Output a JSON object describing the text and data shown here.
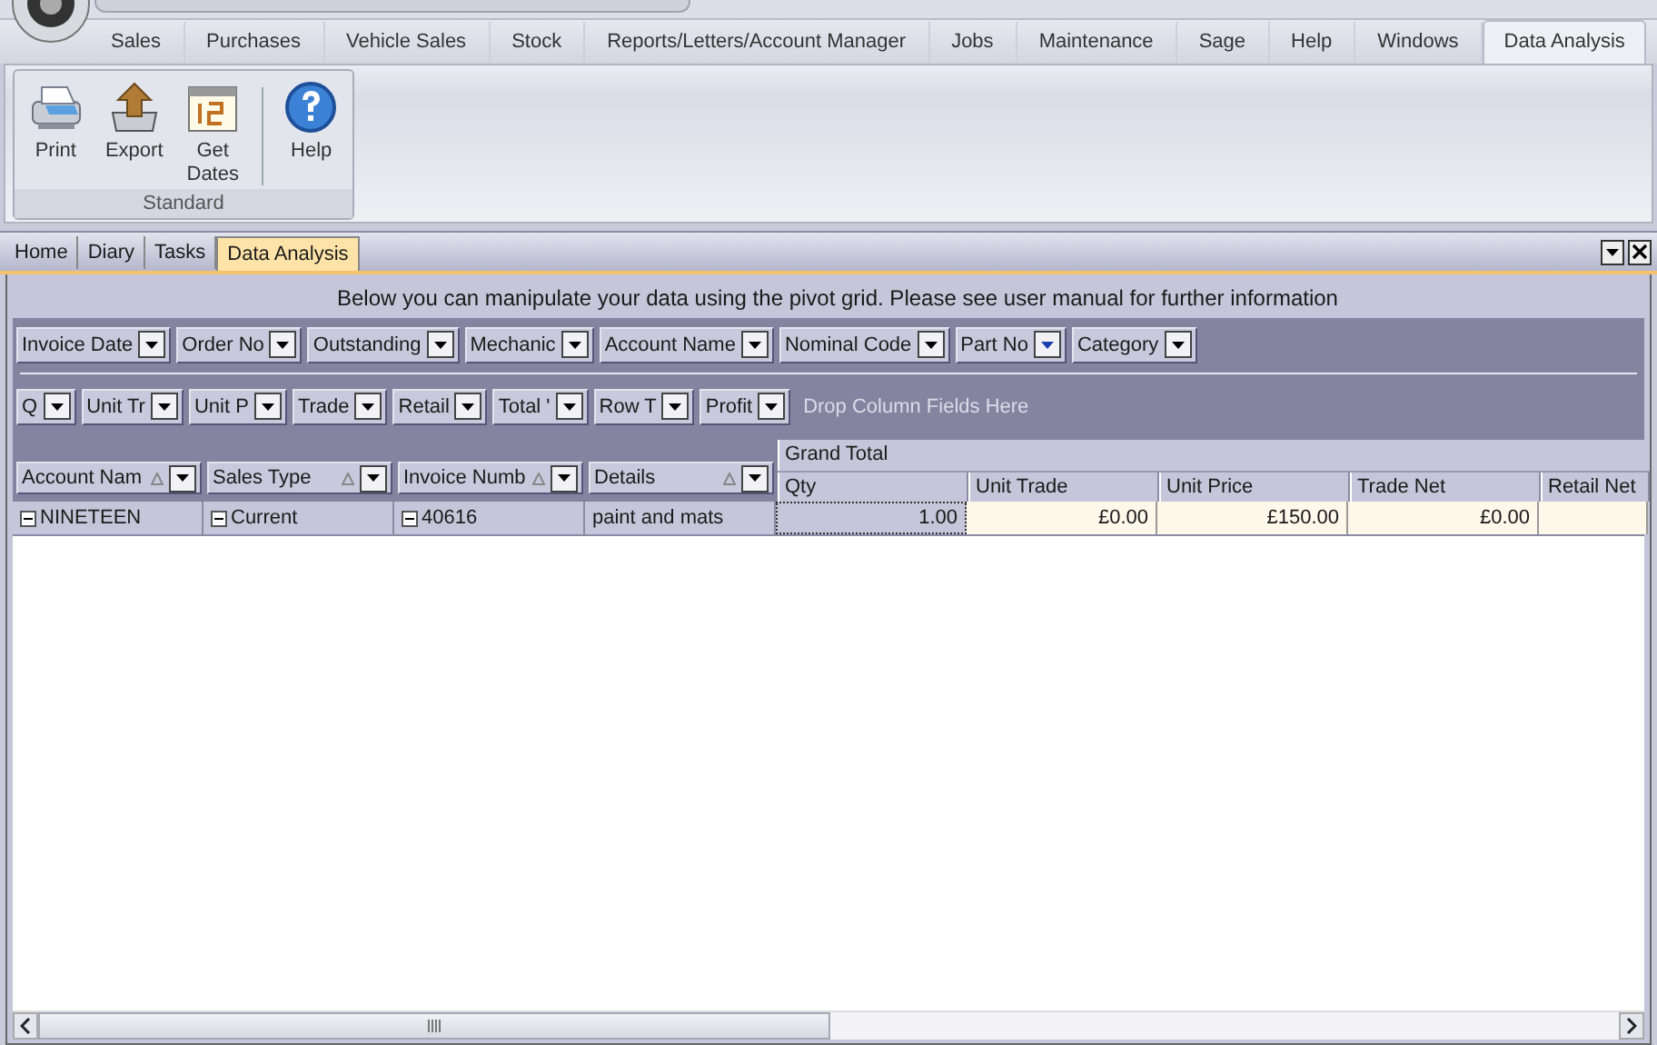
{
  "ribbon_tabs": [
    {
      "label": "Sales",
      "selected": false
    },
    {
      "label": "Purchases",
      "selected": false
    },
    {
      "label": "Vehicle Sales",
      "selected": false
    },
    {
      "label": "Stock",
      "selected": false
    },
    {
      "label": "Reports/Letters/Account Manager",
      "selected": false
    },
    {
      "label": "Jobs",
      "selected": false
    },
    {
      "label": "Maintenance",
      "selected": false
    },
    {
      "label": "Sage",
      "selected": false
    },
    {
      "label": "Help",
      "selected": false
    },
    {
      "label": "Windows",
      "selected": false
    },
    {
      "label": "Data Analysis",
      "selected": true
    }
  ],
  "ribbon_group": {
    "title": "Standard",
    "buttons": [
      {
        "label": "Print",
        "kind": "print"
      },
      {
        "label": "Export",
        "kind": "export"
      },
      {
        "label": "Get Dates",
        "kind": "calendar"
      },
      {
        "label": "Help",
        "kind": "help"
      }
    ]
  },
  "doc_tabs": [
    {
      "label": "Home",
      "selected": false
    },
    {
      "label": "Diary",
      "selected": false
    },
    {
      "label": "Tasks",
      "selected": false
    },
    {
      "label": "Data Analysis",
      "selected": true
    }
  ],
  "info_text": "Below you can manipulate your data using the pivot grid.  Please see user manual for further information",
  "filter_fields": [
    {
      "label": "Invoice Date",
      "filtered": false
    },
    {
      "label": "Order No",
      "filtered": false
    },
    {
      "label": "Outstanding",
      "filtered": false
    },
    {
      "label": "Mechanic",
      "filtered": false
    },
    {
      "label": "Account Name",
      "filtered": false
    },
    {
      "label": "Nominal Code",
      "filtered": false
    },
    {
      "label": "Part No",
      "filtered": true
    },
    {
      "label": "Category",
      "filtered": false
    }
  ],
  "data_fields": [
    {
      "label": "Q"
    },
    {
      "label": "Unit Tr"
    },
    {
      "label": "Unit P"
    },
    {
      "label": "Trade"
    },
    {
      "label": "Retail"
    },
    {
      "label": "Total '"
    },
    {
      "label": "Row T"
    },
    {
      "label": "Profit"
    }
  ],
  "drop_hint": "Drop Column Fields Here",
  "row_fields": [
    {
      "label": "Account Nam"
    },
    {
      "label": "Sales Type"
    },
    {
      "label": "Invoice Numb"
    },
    {
      "label": "Details"
    }
  ],
  "grand_total": "Grand Total",
  "columns": [
    "Qty",
    "Unit Trade",
    "Unit Price",
    "Trade Net",
    "Retail Net"
  ],
  "rows": [
    {
      "headers": [
        {
          "text": "NINETEEN",
          "expanded": true
        },
        {
          "text": "Current",
          "expanded": true
        },
        {
          "text": "40616",
          "expanded": true
        },
        {
          "text": "paint and mats",
          "expanded": false
        }
      ],
      "values": [
        {
          "text": "1.00",
          "selected": true
        },
        {
          "text": "£0.00",
          "selected": false
        },
        {
          "text": "£150.00",
          "selected": false
        },
        {
          "text": "£0.00",
          "selected": false
        }
      ]
    }
  ]
}
